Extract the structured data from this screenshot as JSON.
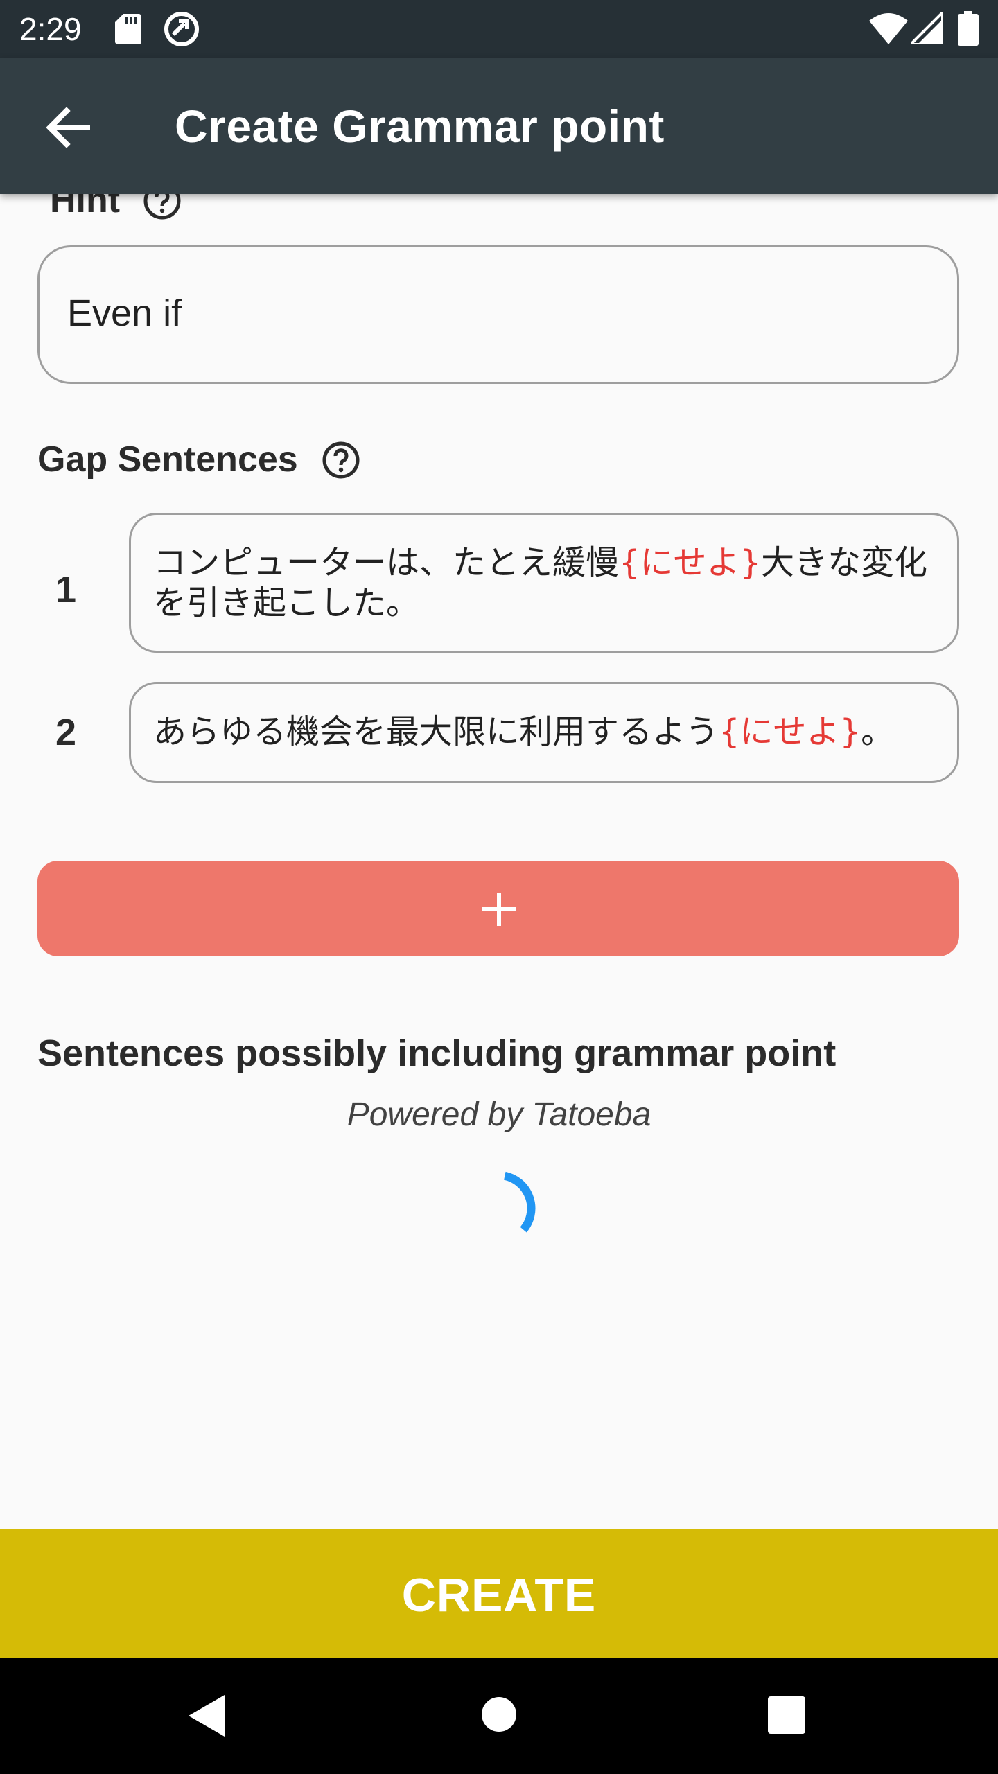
{
  "status_bar": {
    "time": "2:29",
    "icons": [
      "sd-card-icon",
      "sync-icon",
      "wifi-icon",
      "signal-icon",
      "battery-icon"
    ]
  },
  "app_bar": {
    "title": "Create Grammar point",
    "back_icon": "arrow-back-icon"
  },
  "form": {
    "hint_label": "Hint",
    "hint_value": "Even if",
    "gap_sentences_label": "Gap Sentences",
    "sentences": [
      {
        "index": "1",
        "before": "コンピューターは、たとえ緩慢",
        "gap": "{にせよ}",
        "after": "大きな変化を引き起こした。"
      },
      {
        "index": "2",
        "before": "あらゆる機会を最大限に利用するよう",
        "gap": "{にせよ}",
        "after": "。"
      }
    ],
    "add_icon": "plus-icon"
  },
  "suggestions": {
    "title": "Sentences possibly including grammar point",
    "powered_by": "Powered by Tatoeba",
    "loading": true
  },
  "create_button": {
    "label": "CREATE"
  },
  "colors": {
    "status_bar": "#263036",
    "app_bar": "#323e44",
    "add_button": "#ee776b",
    "create_button": "#d5bb06",
    "gap_text": "#e53935",
    "spinner": "#2196f3"
  },
  "nav_bar": {
    "icons": [
      "nav-back-icon",
      "nav-home-icon",
      "nav-recents-icon"
    ]
  }
}
